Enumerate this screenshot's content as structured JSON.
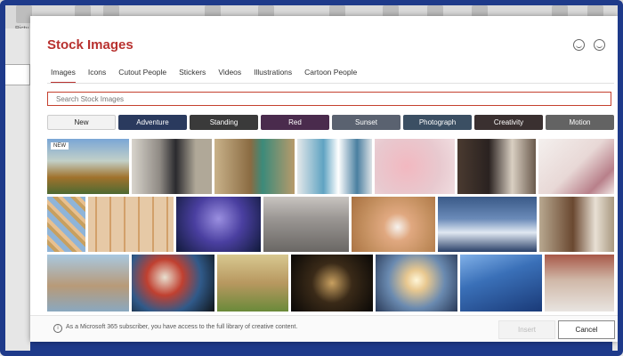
{
  "dialog": {
    "title": "Stock Images",
    "tabs": [
      {
        "label": "Images",
        "active": true
      },
      {
        "label": "Icons"
      },
      {
        "label": "Cutout People"
      },
      {
        "label": "Stickers"
      },
      {
        "label": "Videos"
      },
      {
        "label": "Illustrations"
      },
      {
        "label": "Cartoon People"
      }
    ],
    "search": {
      "placeholder": "Search Stock Images",
      "value": ""
    },
    "filters": [
      {
        "label": "New",
        "color": "#f2f2f2"
      },
      {
        "label": "Adventure",
        "color": "#2a3a5e"
      },
      {
        "label": "Standing",
        "color": "#3a3a3a"
      },
      {
        "label": "Red",
        "color": "#4a2b4d"
      },
      {
        "label": "Sunset",
        "color": "#5a6270"
      },
      {
        "label": "Photograph",
        "color": "#3b4f63"
      },
      {
        "label": "Creativity",
        "color": "#3a3030"
      },
      {
        "label": "Motion",
        "color": "#636363"
      }
    ],
    "new_badge": "NEW",
    "footer": {
      "info_text": "As a Microsoft 365 subscriber, you have access to the full library of creative content.",
      "insert_label": "Insert",
      "cancel_label": "Cancel"
    }
  },
  "background": {
    "ribbon_label": "Pictu"
  }
}
